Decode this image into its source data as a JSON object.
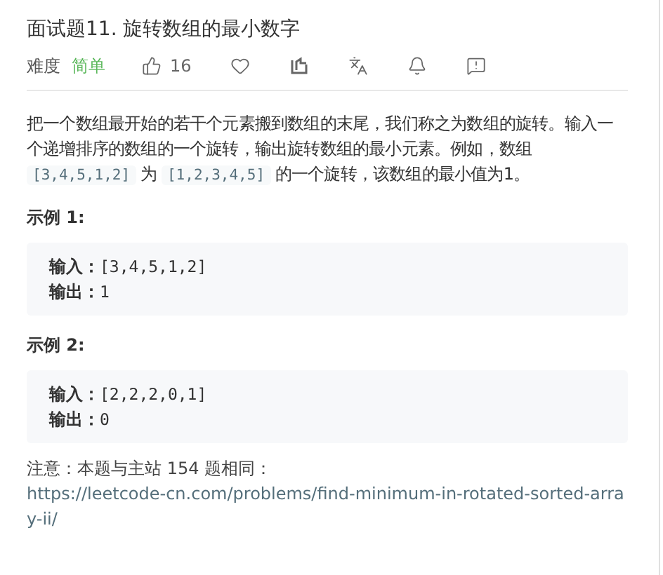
{
  "title": "面试题11. 旋转数组的最小数字",
  "meta": {
    "difficulty_label": "难度",
    "difficulty": "简单",
    "likes": "16",
    "actions": [
      {
        "kind": "like"
      },
      {
        "kind": "favorite"
      },
      {
        "kind": "share"
      },
      {
        "kind": "translate"
      },
      {
        "kind": "notify"
      },
      {
        "kind": "feedback"
      }
    ]
  },
  "description": [
    {
      "kind": "text",
      "text": "把一个数组最开始的若干个元素搬到数组的末尾，我们称之为数组的旋转。输入一个递增排序的数组的一个旋转，输出旋转数组的最小元素。例如，数组 "
    },
    {
      "kind": "code",
      "text": "[3,4,5,1,2]"
    },
    {
      "kind": "text",
      "text": " 为 "
    },
    {
      "kind": "code",
      "text": "[1,2,3,4,5]"
    },
    {
      "kind": "text",
      "text": " 的一个旋转，该数组的最小值为1。"
    }
  ],
  "examples": [
    {
      "heading": "示例 1:",
      "lines": [
        {
          "label": "输入：",
          "value": "[3,4,5,1,2]"
        },
        {
          "label": "输出：",
          "value": "1"
        }
      ]
    },
    {
      "heading": "示例 2:",
      "lines": [
        {
          "label": "输入：",
          "value": "[2,2,2,0,1]"
        },
        {
          "label": "输出：",
          "value": "0"
        }
      ]
    }
  ],
  "note": {
    "text": "注意：本题与主站 154 题相同：",
    "link": "https://leetcode-cn.com/problems/find-minimum-in-rotated-sorted-array-ii/"
  }
}
